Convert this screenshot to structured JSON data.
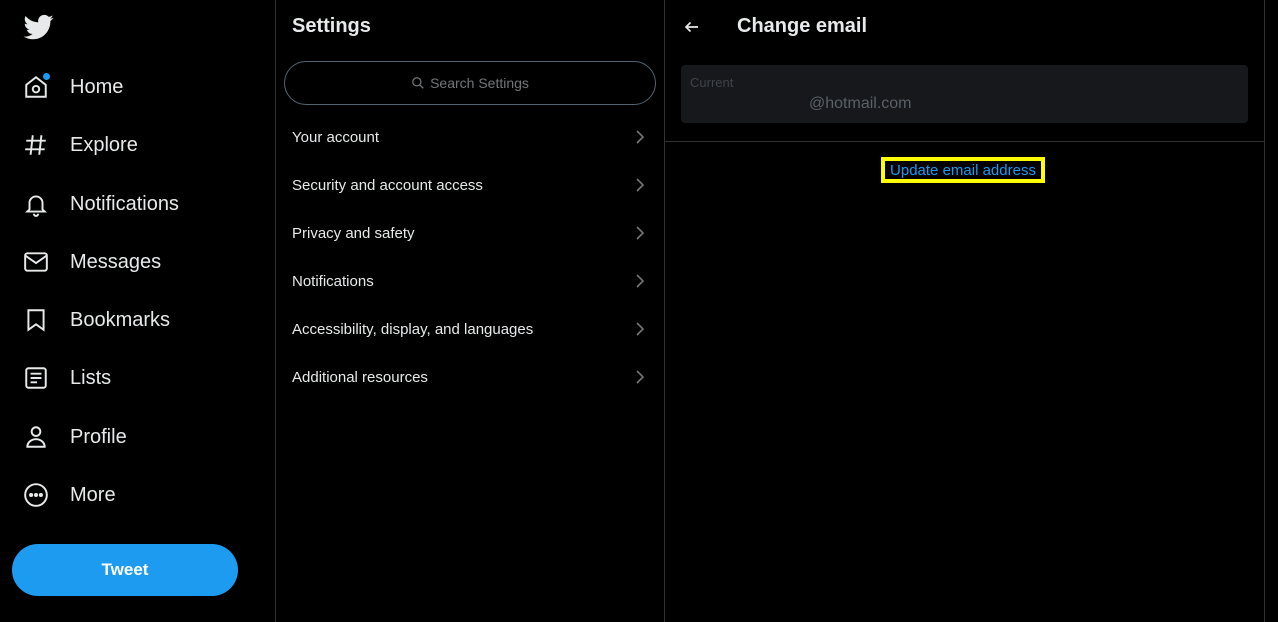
{
  "nav": {
    "logo_icon": "twitter-bird-icon",
    "items": [
      {
        "label": "Home",
        "icon": "home-icon"
      },
      {
        "label": "Explore",
        "icon": "hashtag-icon"
      },
      {
        "label": "Notifications",
        "icon": "bell-icon"
      },
      {
        "label": "Messages",
        "icon": "envelope-icon"
      },
      {
        "label": "Bookmarks",
        "icon": "bookmark-icon"
      },
      {
        "label": "Lists",
        "icon": "list-icon"
      },
      {
        "label": "Profile",
        "icon": "person-icon"
      },
      {
        "label": "More",
        "icon": "more-circle-icon"
      }
    ],
    "tweet_label": "Tweet"
  },
  "settings": {
    "title": "Settings",
    "search_placeholder": "Search Settings",
    "items": [
      {
        "label": "Your account"
      },
      {
        "label": "Security and account access"
      },
      {
        "label": "Privacy and safety"
      },
      {
        "label": "Notifications"
      },
      {
        "label": "Accessibility, display, and languages"
      },
      {
        "label": "Additional resources"
      }
    ]
  },
  "panel": {
    "title": "Change email",
    "current_label": "Current",
    "current_value": "@hotmail.com",
    "update_link": "Update email address"
  },
  "colors": {
    "background": "#000000",
    "accent": "#1d9bf0",
    "text": "#e7e9ea",
    "highlight": "#ffff00",
    "divider": "#2f3336"
  }
}
